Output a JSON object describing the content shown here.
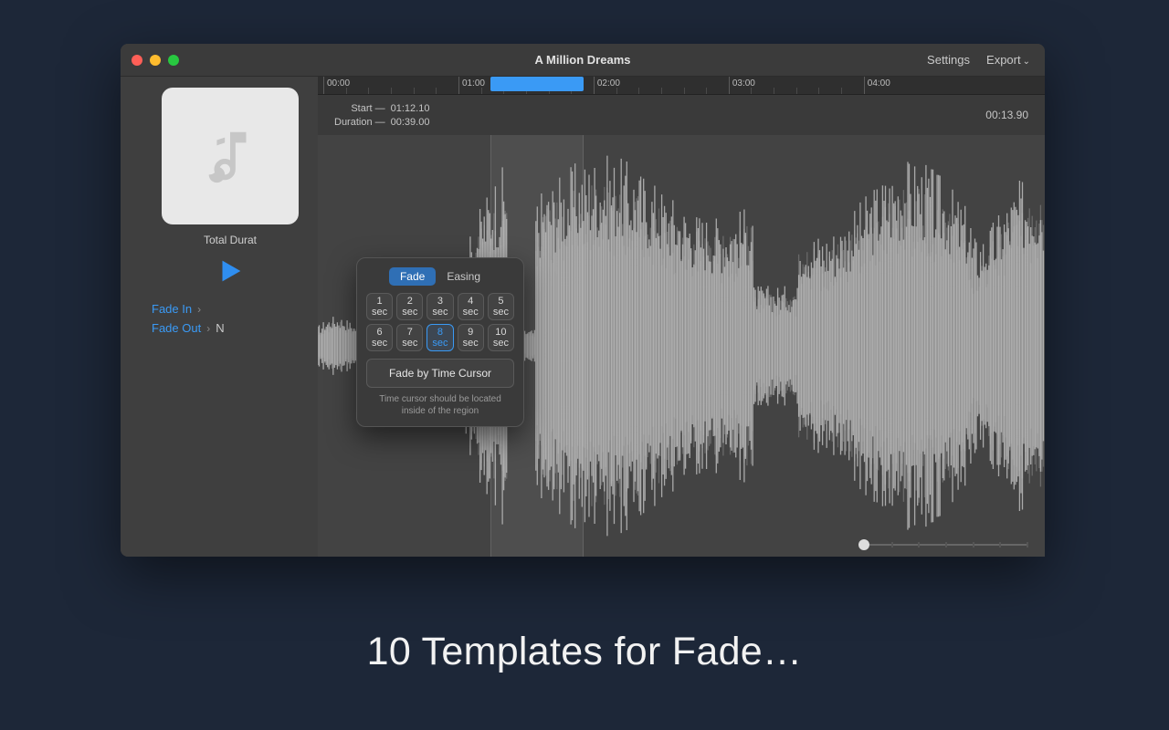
{
  "window_title": "A Million Dreams",
  "titlebar": {
    "settings": "Settings",
    "export": "Export"
  },
  "sidebar": {
    "total_duration_label": "Total Durat",
    "fade_in_label": "Fade In",
    "fade_out_label": "Fade Out",
    "fade_out_value": "N"
  },
  "ruler": {
    "marks": [
      "00:00",
      "01:00",
      "02:00",
      "03:00",
      "04:00"
    ],
    "selection_start_pct": 23.7,
    "selection_width_pct": 12.8
  },
  "info": {
    "start_label": "Start —",
    "start_value": "01:12.10",
    "duration_label": "Duration —",
    "duration_value": "00:39.00",
    "elapsed": "00:13.90"
  },
  "popover": {
    "tab_fade": "Fade",
    "tab_easing": "Easing",
    "secs": [
      "1",
      "2",
      "3",
      "4",
      "5",
      "6",
      "7",
      "8",
      "9",
      "10"
    ],
    "unit": "sec",
    "selected_index": 7,
    "cursor_btn": "Fade by Time Cursor",
    "hint": "Time cursor should be located inside of the region"
  },
  "headline": "10 Templates for Fade…"
}
